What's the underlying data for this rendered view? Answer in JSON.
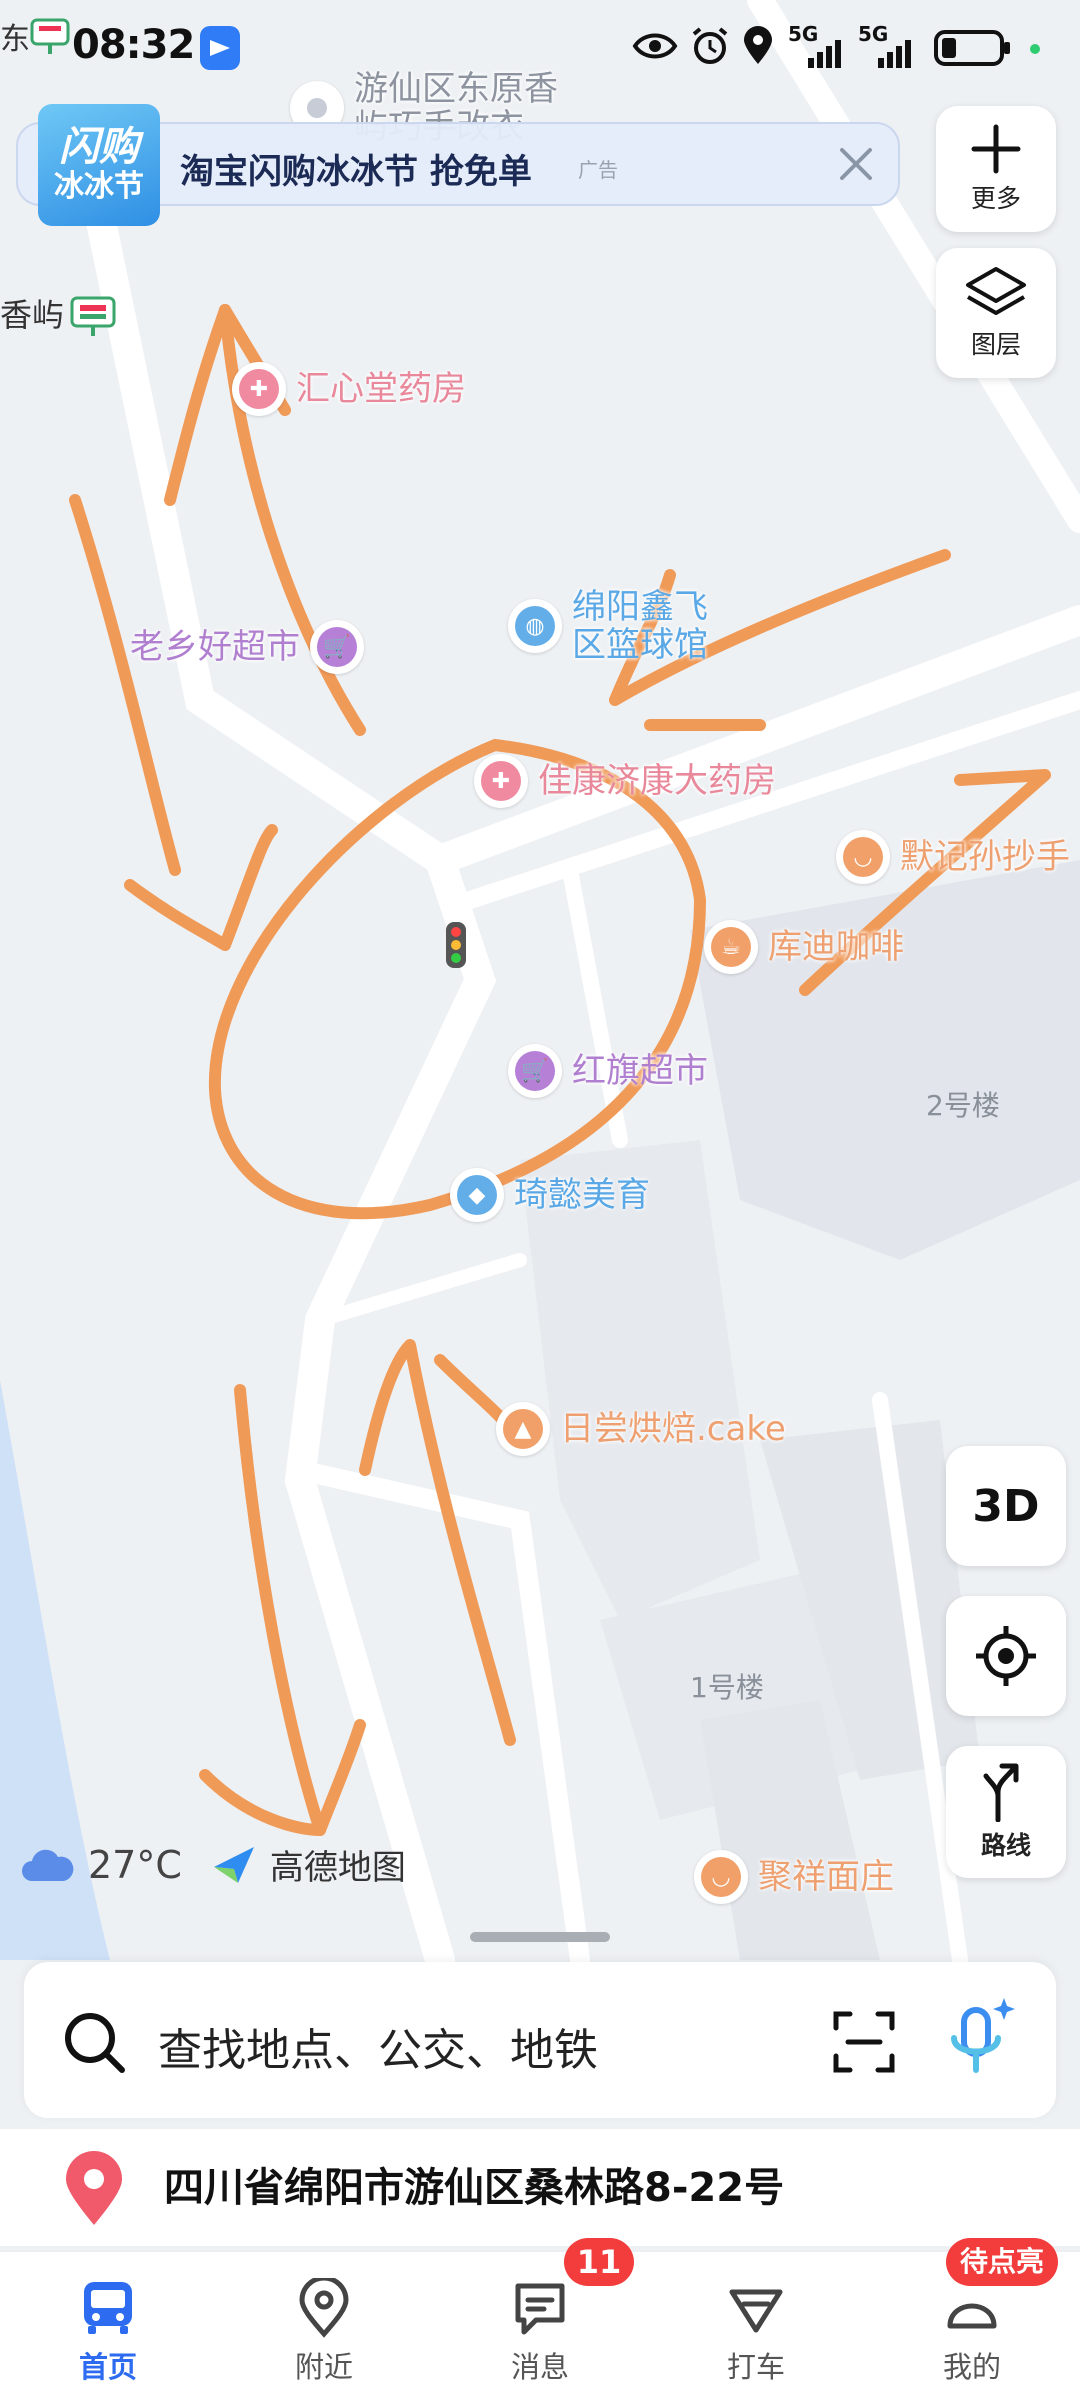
{
  "status_bar": {
    "time": "08:32",
    "signal_labels": [
      "5G",
      "5G"
    ]
  },
  "ad_banner": {
    "logo_line1": "闪购",
    "logo_line2": "冰冰节",
    "text": "淘宝闪购冰冰节 抢免单",
    "tag": "广告"
  },
  "map": {
    "places": [
      {
        "name": "游仙区东原香\n屿巧手改衣",
        "color": "#8d94a0"
      },
      {
        "name": "汇心堂药房",
        "color": "#e8889a"
      },
      {
        "name": "老乡好超市",
        "color": "#b07fd0"
      },
      {
        "name": "绵阳鑫飞\n区篮球馆",
        "color": "#5aa8e6"
      },
      {
        "name": "佳康济康大药房",
        "color": "#e8889a"
      },
      {
        "name": "默记孙抄手",
        "color": "#eea070"
      },
      {
        "name": "库迪咖啡",
        "color": "#eea070"
      },
      {
        "name": "红旗超市",
        "color": "#b07fd0"
      },
      {
        "name": "琦懿美育",
        "color": "#5aa8e6"
      },
      {
        "name": "日尝烘焙.cake",
        "color": "#eea070"
      },
      {
        "name": "聚祥面庄",
        "color": "#eea070"
      }
    ],
    "edge_labels": [
      "东",
      "香屿"
    ],
    "building_labels": [
      "2号楼",
      "1号楼"
    ]
  },
  "controls": {
    "more_label": "更多",
    "layers_label": "图层",
    "three_d_label": "3D",
    "route_label": "路线"
  },
  "weather": {
    "temperature": "27°C",
    "brand": "高德地图"
  },
  "search": {
    "placeholder": "查找地点、公交、地铁"
  },
  "current_address": "四川省绵阳市游仙区桑林路8-22号",
  "tabs": [
    {
      "label": "首页",
      "active": true
    },
    {
      "label": "附近",
      "active": false
    },
    {
      "label": "消息",
      "active": false,
      "badge": "11"
    },
    {
      "label": "打车",
      "active": false
    },
    {
      "label": "我的",
      "active": false,
      "badge": "待点亮"
    }
  ],
  "colors": {
    "accent": "#2d6bf0",
    "annotation": "#f09a58",
    "badge": "#f33d3d"
  }
}
